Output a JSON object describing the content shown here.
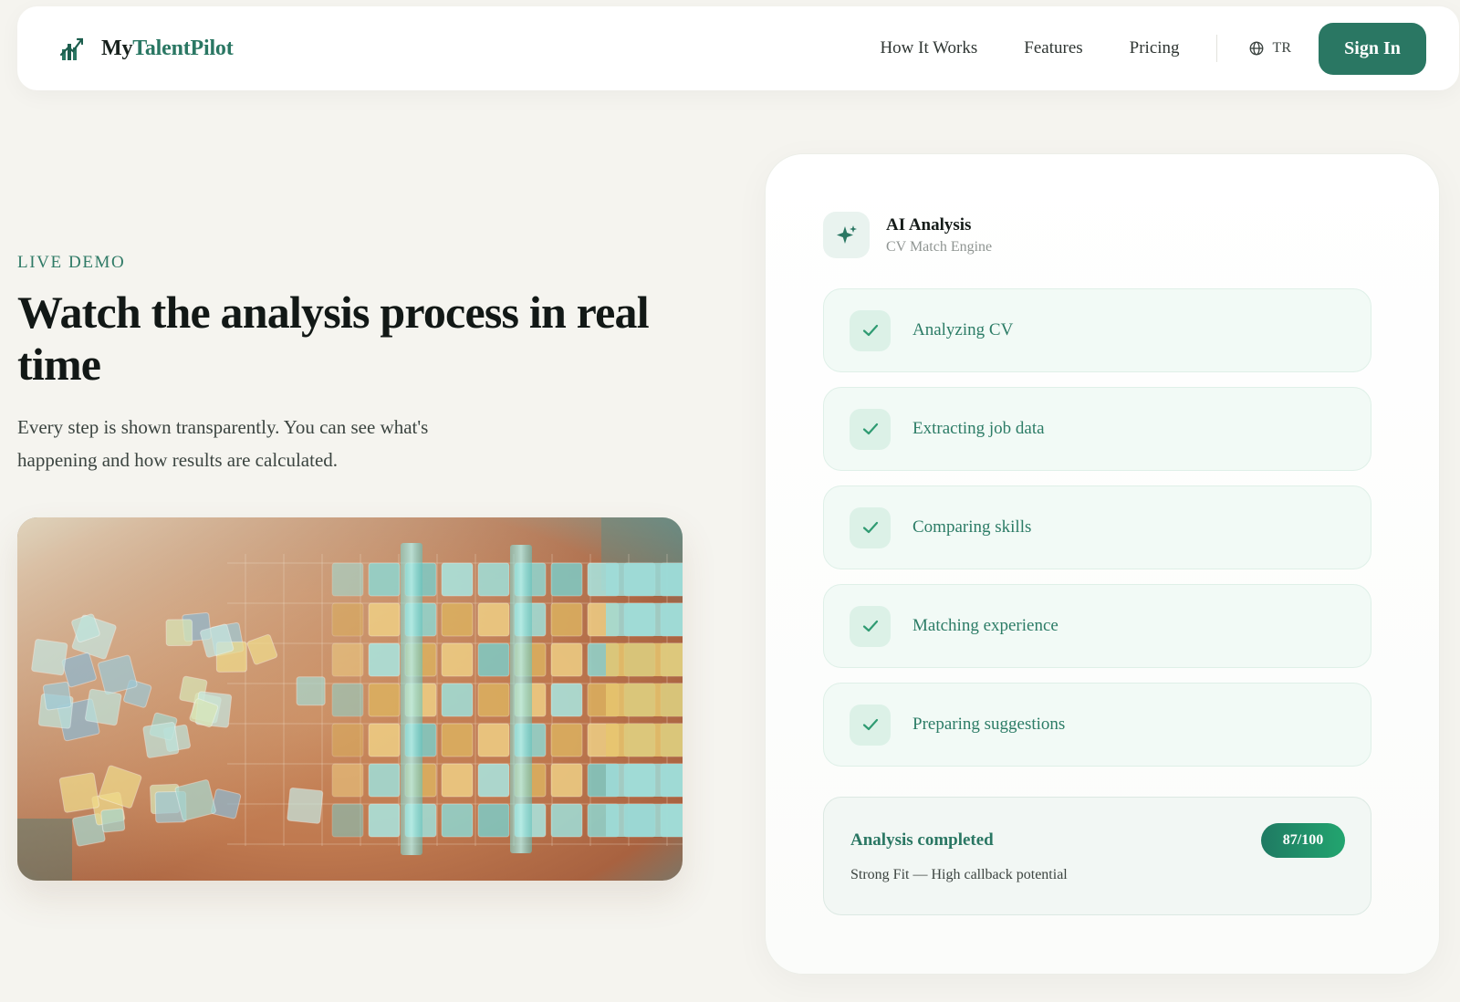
{
  "brand": {
    "name_part1": "My",
    "name_part2": "TalentPilot"
  },
  "nav": {
    "links": [
      "How It Works",
      "Features",
      "Pricing"
    ],
    "language": "TR",
    "signin_label": "Sign In"
  },
  "hero": {
    "eyebrow": "LIVE DEMO",
    "headline": "Watch the analysis process in real time",
    "lead": "Every step is shown transparently. You can see what's happening and how results are calculated."
  },
  "analysis": {
    "title": "AI Analysis",
    "subtitle": "CV Match Engine",
    "steps": [
      {
        "label": "Analyzing CV",
        "status": "done"
      },
      {
        "label": "Extracting job data",
        "status": "done"
      },
      {
        "label": "Comparing skills",
        "status": "done"
      },
      {
        "label": "Matching experience",
        "status": "done"
      },
      {
        "label": "Preparing suggestions",
        "status": "done"
      }
    ],
    "result": {
      "title": "Analysis completed",
      "score": "87/100",
      "detail": "Strong Fit — High callback potential"
    }
  },
  "colors": {
    "accent": "#2a7763",
    "accent_light": "#dcf1e7",
    "background": "#f5f4ef"
  },
  "icons": {
    "brand": "bar-chart-logo-icon",
    "language": "globe-icon",
    "analysis": "sparkle-icon",
    "step": "check-icon"
  }
}
